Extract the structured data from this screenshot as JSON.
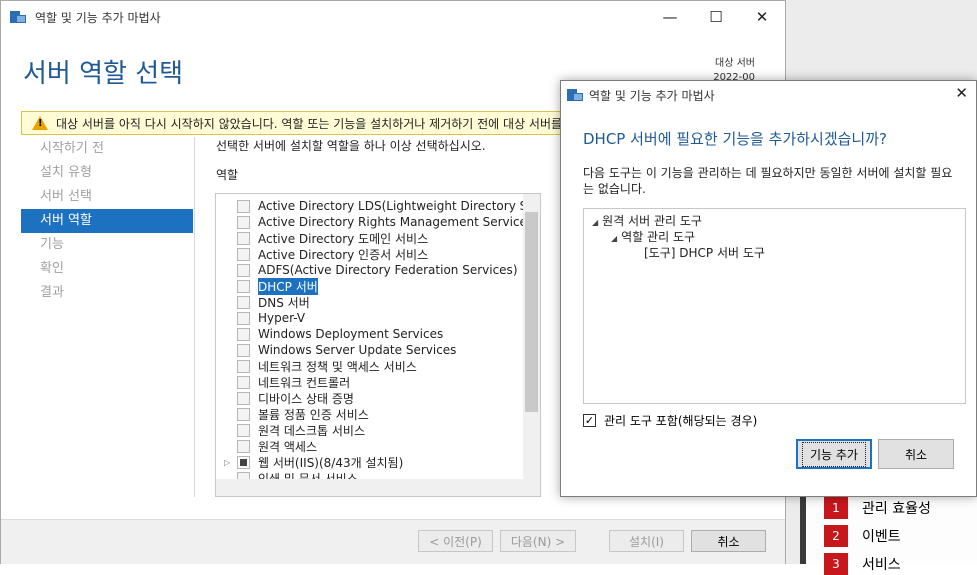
{
  "background": {
    "items": [
      {
        "num": "1",
        "label": "관리 효율성"
      },
      {
        "num": "2",
        "label": "이벤트"
      },
      {
        "num": "3",
        "label": "서비스"
      }
    ]
  },
  "wizard": {
    "title": "역할 및 기능 추가 마법사",
    "heading": "서버 역할 선택",
    "dest_label": "대상 서버",
    "dest_value": "2022-00",
    "warning": "대상 서버를 아직 다시 시작하지 않았습니다. 역할 또는 기능을 설치하거나 제거하기 전에 대상 서버를 다시 시작하십시오.",
    "nav": [
      "시작하기 전",
      "설치 유형",
      "서버 선택",
      "서버 역할",
      "기능",
      "확인",
      "결과"
    ],
    "nav_active": "서버 역할",
    "instruction": "선택한 서버에 설치할 역할을 하나 이상 선택하십시오.",
    "roles_label": "역할",
    "roles": [
      "Active Directory LDS(Lightweight Directory Services)",
      "Active Directory Rights Management Services",
      "Active Directory 도메인 서비스",
      "Active Directory 인증서 서비스",
      "ADFS(Active Directory Federation Services)",
      "DHCP 서버",
      "DNS 서버",
      "Hyper-V",
      "Windows Deployment Services",
      "Windows Server Update Services",
      "네트워크 정책 및 액세스 서비스",
      "네트워크 컨트롤러",
      "디바이스 상태 증명",
      "볼륨 정품 인증 서비스",
      "원격 데스크톱 서비스",
      "원격 액세스",
      "웹 서버(IIS)(8/43개 설치됨)",
      "인쇄 및 문서 서비스"
    ],
    "selected_role": "DHCP 서버",
    "footer": {
      "prev": "< 이전(P)",
      "next": "다음(N) >",
      "install": "설치(I)",
      "cancel": "취소"
    }
  },
  "dialog": {
    "title": "역할 및 기능 추가 마법사",
    "heading": "DHCP 서버에 필요한 기능을 추가하시겠습니까?",
    "description": "다음 도구는 이 기능을 관리하는 데 필요하지만 동일한 서버에 설치할 필요는 없습니다.",
    "tree": [
      {
        "label": "원격 서버 관리 도구",
        "arrow": "◢"
      },
      {
        "label": "역할 관리 도구",
        "arrow": "◢"
      },
      {
        "label": "[도구] DHCP 서버 도구",
        "arrow": ""
      }
    ],
    "include_label": "관리 도구 포함(해당되는 경우)",
    "include_checked": true,
    "add_button": "기능 추가",
    "cancel_button": "취소"
  }
}
